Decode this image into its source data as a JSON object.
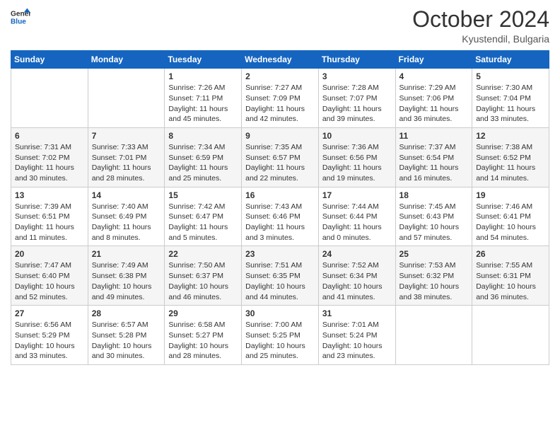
{
  "header": {
    "logo_general": "General",
    "logo_blue": "Blue",
    "month_title": "October 2024",
    "location": "Kyustendil, Bulgaria"
  },
  "days_of_week": [
    "Sunday",
    "Monday",
    "Tuesday",
    "Wednesday",
    "Thursday",
    "Friday",
    "Saturday"
  ],
  "weeks": [
    [
      {
        "day": "",
        "sunrise": "",
        "sunset": "",
        "daylight": ""
      },
      {
        "day": "",
        "sunrise": "",
        "sunset": "",
        "daylight": ""
      },
      {
        "day": "1",
        "sunrise": "Sunrise: 7:26 AM",
        "sunset": "Sunset: 7:11 PM",
        "daylight": "Daylight: 11 hours and 45 minutes."
      },
      {
        "day": "2",
        "sunrise": "Sunrise: 7:27 AM",
        "sunset": "Sunset: 7:09 PM",
        "daylight": "Daylight: 11 hours and 42 minutes."
      },
      {
        "day": "3",
        "sunrise": "Sunrise: 7:28 AM",
        "sunset": "Sunset: 7:07 PM",
        "daylight": "Daylight: 11 hours and 39 minutes."
      },
      {
        "day": "4",
        "sunrise": "Sunrise: 7:29 AM",
        "sunset": "Sunset: 7:06 PM",
        "daylight": "Daylight: 11 hours and 36 minutes."
      },
      {
        "day": "5",
        "sunrise": "Sunrise: 7:30 AM",
        "sunset": "Sunset: 7:04 PM",
        "daylight": "Daylight: 11 hours and 33 minutes."
      }
    ],
    [
      {
        "day": "6",
        "sunrise": "Sunrise: 7:31 AM",
        "sunset": "Sunset: 7:02 PM",
        "daylight": "Daylight: 11 hours and 30 minutes."
      },
      {
        "day": "7",
        "sunrise": "Sunrise: 7:33 AM",
        "sunset": "Sunset: 7:01 PM",
        "daylight": "Daylight: 11 hours and 28 minutes."
      },
      {
        "day": "8",
        "sunrise": "Sunrise: 7:34 AM",
        "sunset": "Sunset: 6:59 PM",
        "daylight": "Daylight: 11 hours and 25 minutes."
      },
      {
        "day": "9",
        "sunrise": "Sunrise: 7:35 AM",
        "sunset": "Sunset: 6:57 PM",
        "daylight": "Daylight: 11 hours and 22 minutes."
      },
      {
        "day": "10",
        "sunrise": "Sunrise: 7:36 AM",
        "sunset": "Sunset: 6:56 PM",
        "daylight": "Daylight: 11 hours and 19 minutes."
      },
      {
        "day": "11",
        "sunrise": "Sunrise: 7:37 AM",
        "sunset": "Sunset: 6:54 PM",
        "daylight": "Daylight: 11 hours and 16 minutes."
      },
      {
        "day": "12",
        "sunrise": "Sunrise: 7:38 AM",
        "sunset": "Sunset: 6:52 PM",
        "daylight": "Daylight: 11 hours and 14 minutes."
      }
    ],
    [
      {
        "day": "13",
        "sunrise": "Sunrise: 7:39 AM",
        "sunset": "Sunset: 6:51 PM",
        "daylight": "Daylight: 11 hours and 11 minutes."
      },
      {
        "day": "14",
        "sunrise": "Sunrise: 7:40 AM",
        "sunset": "Sunset: 6:49 PM",
        "daylight": "Daylight: 11 hours and 8 minutes."
      },
      {
        "day": "15",
        "sunrise": "Sunrise: 7:42 AM",
        "sunset": "Sunset: 6:47 PM",
        "daylight": "Daylight: 11 hours and 5 minutes."
      },
      {
        "day": "16",
        "sunrise": "Sunrise: 7:43 AM",
        "sunset": "Sunset: 6:46 PM",
        "daylight": "Daylight: 11 hours and 3 minutes."
      },
      {
        "day": "17",
        "sunrise": "Sunrise: 7:44 AM",
        "sunset": "Sunset: 6:44 PM",
        "daylight": "Daylight: 11 hours and 0 minutes."
      },
      {
        "day": "18",
        "sunrise": "Sunrise: 7:45 AM",
        "sunset": "Sunset: 6:43 PM",
        "daylight": "Daylight: 10 hours and 57 minutes."
      },
      {
        "day": "19",
        "sunrise": "Sunrise: 7:46 AM",
        "sunset": "Sunset: 6:41 PM",
        "daylight": "Daylight: 10 hours and 54 minutes."
      }
    ],
    [
      {
        "day": "20",
        "sunrise": "Sunrise: 7:47 AM",
        "sunset": "Sunset: 6:40 PM",
        "daylight": "Daylight: 10 hours and 52 minutes."
      },
      {
        "day": "21",
        "sunrise": "Sunrise: 7:49 AM",
        "sunset": "Sunset: 6:38 PM",
        "daylight": "Daylight: 10 hours and 49 minutes."
      },
      {
        "day": "22",
        "sunrise": "Sunrise: 7:50 AM",
        "sunset": "Sunset: 6:37 PM",
        "daylight": "Daylight: 10 hours and 46 minutes."
      },
      {
        "day": "23",
        "sunrise": "Sunrise: 7:51 AM",
        "sunset": "Sunset: 6:35 PM",
        "daylight": "Daylight: 10 hours and 44 minutes."
      },
      {
        "day": "24",
        "sunrise": "Sunrise: 7:52 AM",
        "sunset": "Sunset: 6:34 PM",
        "daylight": "Daylight: 10 hours and 41 minutes."
      },
      {
        "day": "25",
        "sunrise": "Sunrise: 7:53 AM",
        "sunset": "Sunset: 6:32 PM",
        "daylight": "Daylight: 10 hours and 38 minutes."
      },
      {
        "day": "26",
        "sunrise": "Sunrise: 7:55 AM",
        "sunset": "Sunset: 6:31 PM",
        "daylight": "Daylight: 10 hours and 36 minutes."
      }
    ],
    [
      {
        "day": "27",
        "sunrise": "Sunrise: 6:56 AM",
        "sunset": "Sunset: 5:29 PM",
        "daylight": "Daylight: 10 hours and 33 minutes."
      },
      {
        "day": "28",
        "sunrise": "Sunrise: 6:57 AM",
        "sunset": "Sunset: 5:28 PM",
        "daylight": "Daylight: 10 hours and 30 minutes."
      },
      {
        "day": "29",
        "sunrise": "Sunrise: 6:58 AM",
        "sunset": "Sunset: 5:27 PM",
        "daylight": "Daylight: 10 hours and 28 minutes."
      },
      {
        "day": "30",
        "sunrise": "Sunrise: 7:00 AM",
        "sunset": "Sunset: 5:25 PM",
        "daylight": "Daylight: 10 hours and 25 minutes."
      },
      {
        "day": "31",
        "sunrise": "Sunrise: 7:01 AM",
        "sunset": "Sunset: 5:24 PM",
        "daylight": "Daylight: 10 hours and 23 minutes."
      },
      {
        "day": "",
        "sunrise": "",
        "sunset": "",
        "daylight": ""
      },
      {
        "day": "",
        "sunrise": "",
        "sunset": "",
        "daylight": ""
      }
    ]
  ]
}
